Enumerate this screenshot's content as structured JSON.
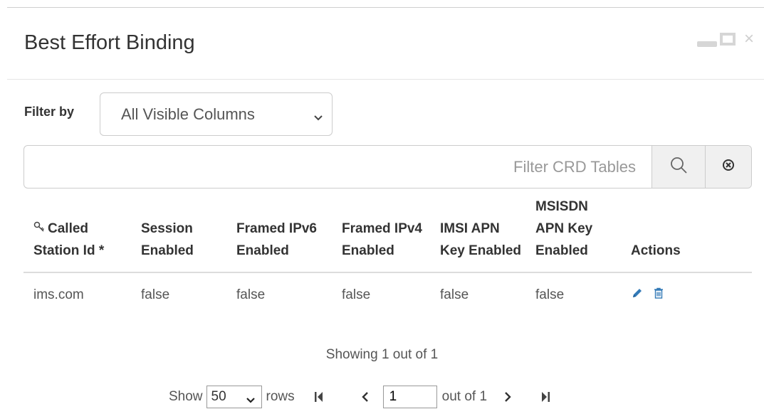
{
  "modal": {
    "title": "Best Effort Binding"
  },
  "filter": {
    "label": "Filter by",
    "selected": "All Visible Columns"
  },
  "search": {
    "placeholder": "Filter CRD Tables"
  },
  "table": {
    "columns": [
      "Called Station Id *",
      "Session Enabled",
      "Framed IPv6 Enabled",
      "Framed IPv4 Enabled",
      "IMSI APN Key Enabled",
      "MSISDN APN Key Enabled",
      "Actions"
    ],
    "rows": [
      [
        "ims.com",
        "false",
        "false",
        "false",
        "false",
        "false"
      ]
    ]
  },
  "status": {
    "showing": "Showing 1 out of 1"
  },
  "pager": {
    "show_label": "Show",
    "rows_per_page": "50",
    "rows_label": "rows",
    "current_page": "1",
    "out_of": "out of 1"
  },
  "colors": {
    "accent": "#337ab7",
    "border": "#cccccc",
    "text": "#333333"
  }
}
